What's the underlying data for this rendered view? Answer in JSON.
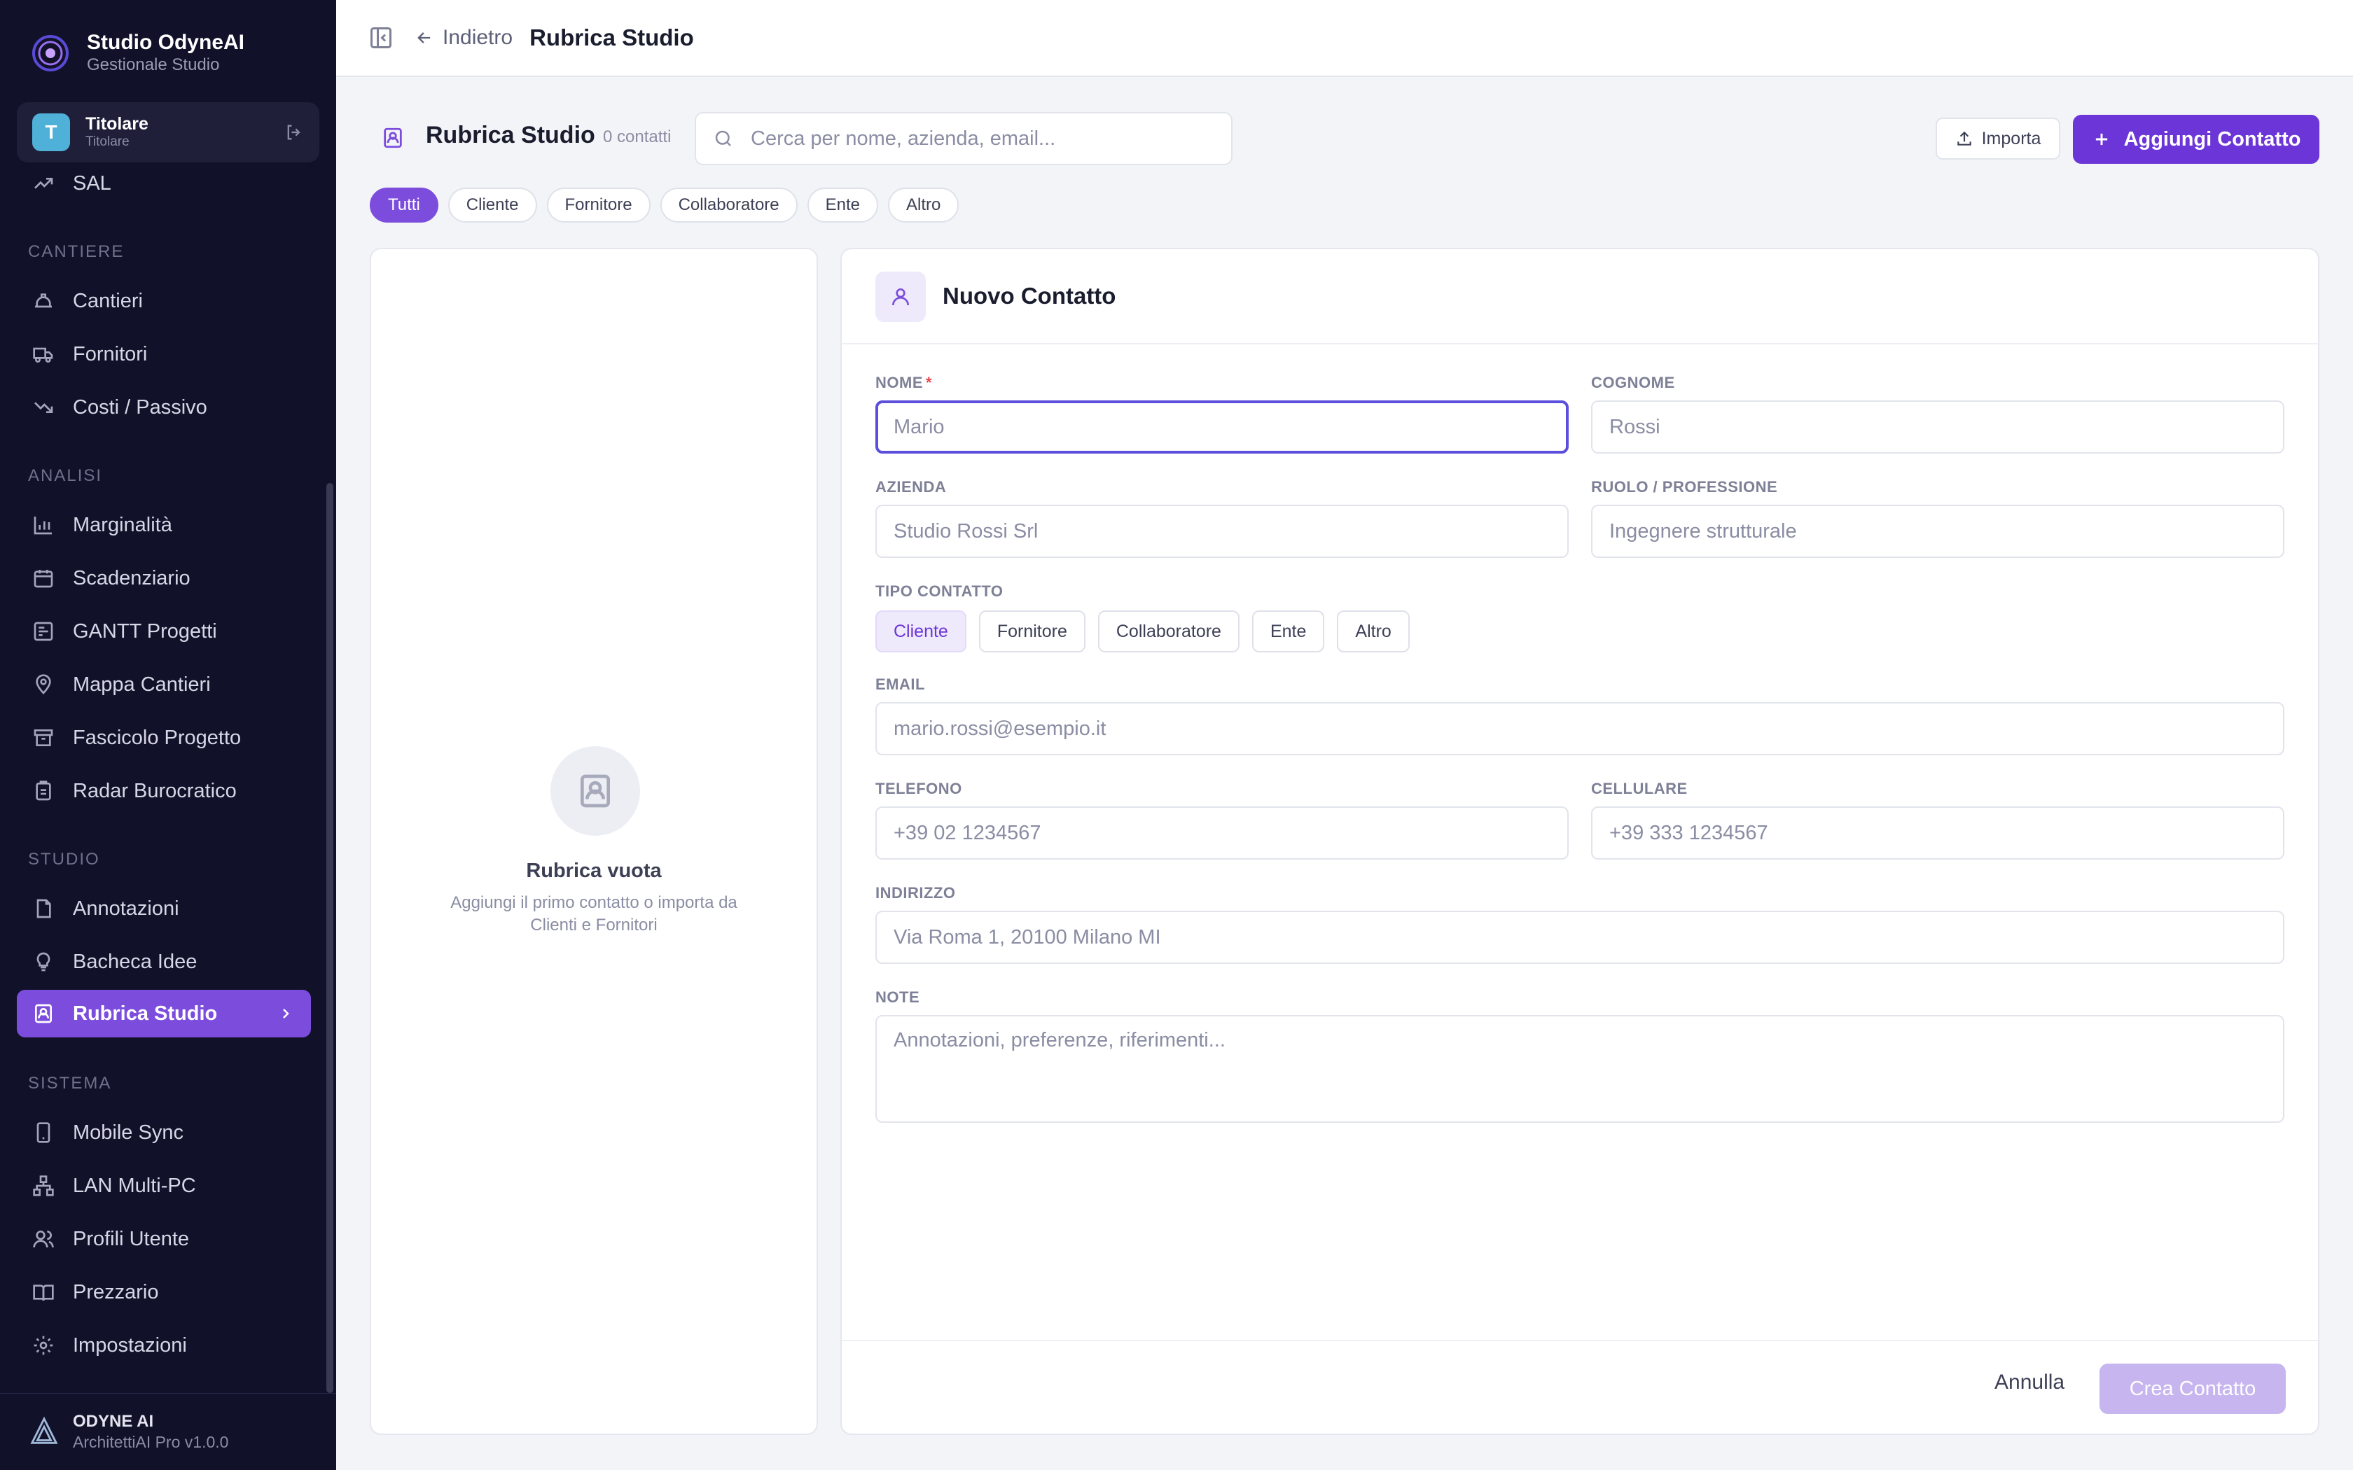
{
  "brand": {
    "title": "Studio OdyneAI",
    "subtitle": "Gestionale Studio"
  },
  "user": {
    "initial": "T",
    "name": "Titolare",
    "role": "Titolare"
  },
  "sidebar": {
    "sections": {
      "cantiere": "CANTIERE",
      "analisi": "ANALISI",
      "studio": "STUDIO",
      "sistema": "SISTEMA"
    },
    "items": {
      "sal": "SAL",
      "cantieri": "Cantieri",
      "fornitori": "Fornitori",
      "costi": "Costi / Passivo",
      "marginalita": "Marginalità",
      "scadenziario": "Scadenziario",
      "gantt": "GANTT Progetti",
      "mappa": "Mappa Cantieri",
      "fascicolo": "Fascicolo Progetto",
      "radar": "Radar Burocratico",
      "annotazioni": "Annotazioni",
      "bacheca": "Bacheca Idee",
      "rubrica": "Rubrica Studio",
      "mobile": "Mobile Sync",
      "lan": "LAN Multi-PC",
      "profili": "Profili Utente",
      "prezzario": "Prezzario",
      "impostazioni": "Impostazioni"
    },
    "footer": {
      "title": "ODYNE AI",
      "subtitle": "ArchitettiAI Pro v1.0.0"
    }
  },
  "topbar": {
    "back_label": "Indietro",
    "title": "Rubrica Studio"
  },
  "toolbar": {
    "title": "Rubrica Studio",
    "count": "0 contatti",
    "search_placeholder": "Cerca per nome, azienda, email...",
    "import_label": "Importa",
    "add_label": "Aggiungi Contatto"
  },
  "filters": [
    "Tutti",
    "Cliente",
    "Fornitore",
    "Collaboratore",
    "Ente",
    "Altro"
  ],
  "active_filter": "Tutti",
  "empty_state": {
    "title": "Rubrica vuota",
    "description": "Aggiungi il primo contatto o importa da Clienti e Fornitori"
  },
  "form": {
    "title": "Nuovo Contatto",
    "fields": {
      "nome": {
        "label": "NOME",
        "required_mark": "*",
        "placeholder": "Mario",
        "value": ""
      },
      "cognome": {
        "label": "COGNOME",
        "placeholder": "Rossi",
        "value": ""
      },
      "azienda": {
        "label": "AZIENDA",
        "placeholder": "Studio Rossi Srl",
        "value": ""
      },
      "ruolo": {
        "label": "RUOLO / PROFESSIONE",
        "placeholder": "Ingegnere strutturale",
        "value": ""
      },
      "tipo": {
        "label": "TIPO CONTATTO",
        "options": [
          "Cliente",
          "Fornitore",
          "Collaboratore",
          "Ente",
          "Altro"
        ],
        "selected": "Cliente"
      },
      "email": {
        "label": "EMAIL",
        "placeholder": "mario.rossi@esempio.it",
        "value": ""
      },
      "telefono": {
        "label": "TELEFONO",
        "placeholder": "+39 02 1234567",
        "value": ""
      },
      "cellulare": {
        "label": "CELLULARE",
        "placeholder": "+39 333 1234567",
        "value": ""
      },
      "indirizzo": {
        "label": "INDIRIZZO",
        "placeholder": "Via Roma 1, 20100 Milano MI",
        "value": ""
      },
      "note": {
        "label": "NOTE",
        "placeholder": "Annotazioni, preferenze, riferimenti...",
        "value": ""
      }
    },
    "cancel_label": "Annulla",
    "submit_label": "Crea Contatto"
  },
  "colors": {
    "accent": "#6b35d8",
    "sidebar_bg": "#111129",
    "active_nav": "#7c4ddd",
    "focus_ring": "#5b4fdc"
  }
}
